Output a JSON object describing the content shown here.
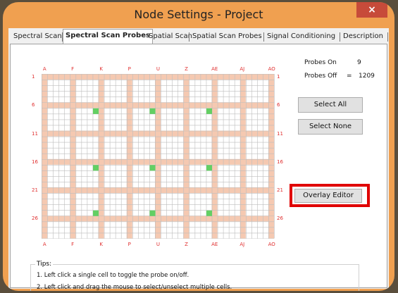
{
  "window": {
    "title": "Node Settings - Project",
    "close_label": "×"
  },
  "tabs": [
    {
      "label": "Spectral Scan",
      "active": false
    },
    {
      "label": "Spectral Scan Probes",
      "active": true
    },
    {
      "label": "Spatial Scan",
      "active": false
    },
    {
      "label": "Spatial Scan Probes",
      "active": false
    },
    {
      "label": "Signal Conditioning",
      "active": false
    },
    {
      "label": "Description",
      "active": false
    }
  ],
  "grid": {
    "columns": 41,
    "rows": 29,
    "column_labels": [
      "A",
      "F",
      "K",
      "P",
      "U",
      "Z",
      "AE",
      "AJ",
      "AO"
    ],
    "row_labels": [
      "1",
      "6",
      "11",
      "16",
      "21",
      "26"
    ],
    "probes_on_cells": [
      [
        9,
        6
      ],
      [
        19,
        6
      ],
      [
        29,
        6
      ],
      [
        9,
        16
      ],
      [
        19,
        16
      ],
      [
        29,
        16
      ],
      [
        9,
        24
      ],
      [
        19,
        24
      ],
      [
        29,
        24
      ]
    ],
    "colors": {
      "highlight_band": "#f5c9b1",
      "probe_on": "#63cf63",
      "cell_border": "#bdbdbd",
      "label": "#e03030"
    }
  },
  "probes": {
    "on_label": "Probes On",
    "on_value": "9",
    "off_label": "Probes Off",
    "off_equals": "=",
    "off_value": "1209"
  },
  "buttons": {
    "select_all": "Select All",
    "select_none": "Select None",
    "overlay_editor": "Overlay Editor"
  },
  "tips": {
    "title": "Tips:",
    "lines": [
      "1. Left click a single cell to toggle the probe on/off.",
      "2. Left click and drag the mouse to select/unselect multiple cells."
    ]
  }
}
